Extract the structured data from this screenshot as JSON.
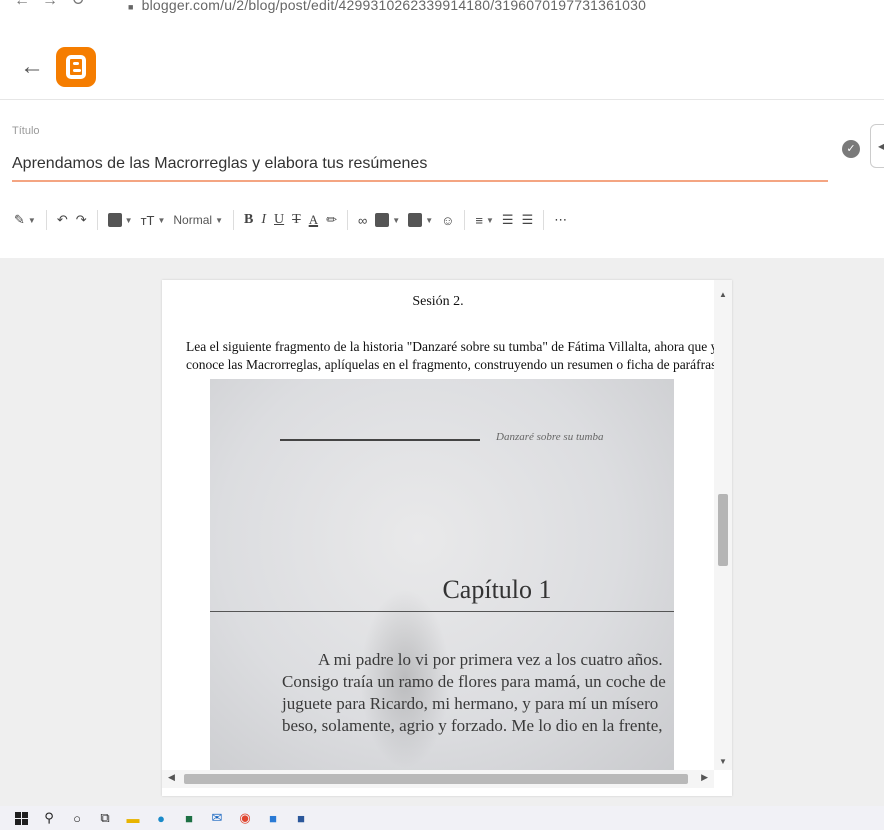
{
  "browser": {
    "url": "blogger.com/u/2/blog/post/edit/4299310262339914180/3196070197731361030"
  },
  "app": {
    "title_label": "Título",
    "post_title": "Aprendamos de las Macrorreglas y elabora tus resúmenes"
  },
  "toolbar": {
    "paragraph_style": "Normal"
  },
  "document": {
    "heading": "Sesión 2.",
    "instruction_line1": "Lea el siguiente fragmento de la historia \"Danzaré sobre su tumba\" de Fátima Villalta, ahora que ya",
    "instruction_line2": "conoce las Macrorreglas, aplíquelas en el fragmento, construyendo un resumen o ficha de paráfrasis"
  },
  "photo": {
    "running_head": "Danzaré sobre su tumba",
    "chapter_title": "Capítulo 1",
    "text_lines": [
      "A mi padre lo vi por primera vez a los cuatro años.",
      "Consigo traía un ramo de flores para mamá, un coche de",
      "juguete para Ricardo, mi hermano, y para mí un mísero",
      "beso, solamente, agrio y forzado. Me lo dio en la frente,"
    ]
  },
  "colors": {
    "blogger_orange": "#f57d00",
    "title_underline": "#f4a582"
  },
  "taskbar": {
    "icons": [
      "windows-start",
      "search",
      "cortana",
      "task-view",
      "file-explorer",
      "edge",
      "excel",
      "mail",
      "chrome",
      "photos",
      "word"
    ]
  }
}
